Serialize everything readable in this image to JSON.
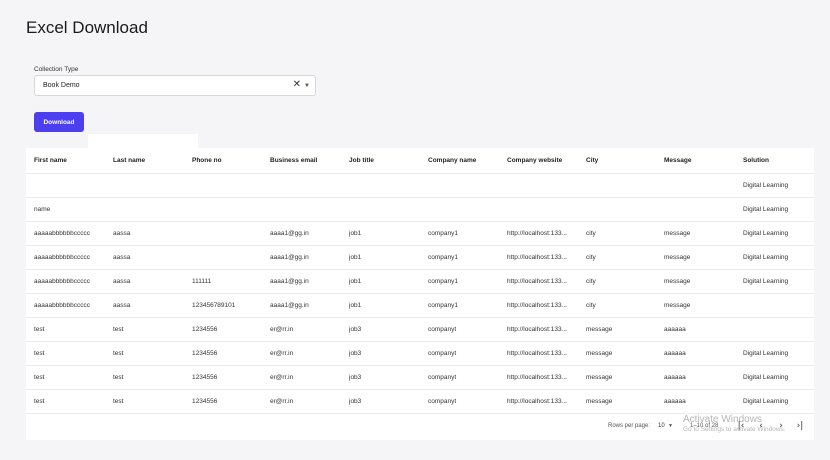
{
  "page": {
    "title": "Excel Download"
  },
  "form": {
    "collection_label": "Collection Type",
    "collection_value": "Book Demo",
    "download_label": "Download"
  },
  "icons": {
    "clear": "close-icon",
    "dropdown": "chevron-down-icon",
    "first_page": "first-page-icon",
    "prev_page": "chevron-left-icon",
    "next_page": "chevron-right-icon",
    "last_page": "last-page-icon"
  },
  "colors": {
    "accent": "#4c3ff0",
    "background": "#f5f5f8"
  },
  "table": {
    "columns": [
      "First name",
      "Last name",
      "Phone no",
      "Business email",
      "Job title",
      "Company name",
      "Company website",
      "City",
      "Message",
      "Solution"
    ],
    "rows": [
      [
        "",
        "",
        "",
        "",
        "",
        "",
        "",
        "",
        "",
        "Digital Learning"
      ],
      [
        "name",
        "",
        "",
        "",
        "",
        "",
        "",
        "",
        "",
        "Digital Learning"
      ],
      [
        "aaaaabbbbbbccccc",
        "aassa",
        "",
        "aaaa1@gg.in",
        "job1",
        "company1",
        "http://localhost:133...",
        "city",
        "message",
        "Digital Learning"
      ],
      [
        "aaaaabbbbbbccccc",
        "aassa",
        "",
        "aaaa1@gg.in",
        "job1",
        "company1",
        "http://localhost:133...",
        "city",
        "message",
        "Digital Learning"
      ],
      [
        "aaaaabbbbbbccccc",
        "aassa",
        "111111",
        "aaaa1@gg.in",
        "job1",
        "company1",
        "http://localhost:133...",
        "city",
        "message",
        "Digital Learning"
      ],
      [
        "aaaaabbbbbbccccc",
        "aassa",
        "123456789101",
        "aaaa1@gg.in",
        "job1",
        "company1",
        "http://localhost:133...",
        "city",
        "message",
        ""
      ],
      [
        "test",
        "test",
        "1234556",
        "er@rr.in",
        "job3",
        "companyt",
        "http://localhost:133...",
        "message",
        "aaaaaa",
        ""
      ],
      [
        "test",
        "test",
        "1234556",
        "er@rr.in",
        "job3",
        "companyt",
        "http://localhost:133...",
        "message",
        "aaaaaa",
        "Digital Learning"
      ],
      [
        "test",
        "test",
        "1234556",
        "er@rr.in",
        "job3",
        "companyt",
        "http://localhost:133...",
        "message",
        "aaaaaa",
        "Digital Learning"
      ],
      [
        "test",
        "test",
        "1234556",
        "er@rr.in",
        "job3",
        "companyt",
        "http://localhost:133...",
        "message",
        "aaaaaa",
        "Digital Learning"
      ]
    ]
  },
  "pagination": {
    "rows_per_page_label": "Rows per page:",
    "rows_per_page_value": "10",
    "range": "1–10 of 28"
  },
  "watermark": {
    "title": "Activate Windows",
    "subtitle": "Go to Settings to activate Windows."
  }
}
